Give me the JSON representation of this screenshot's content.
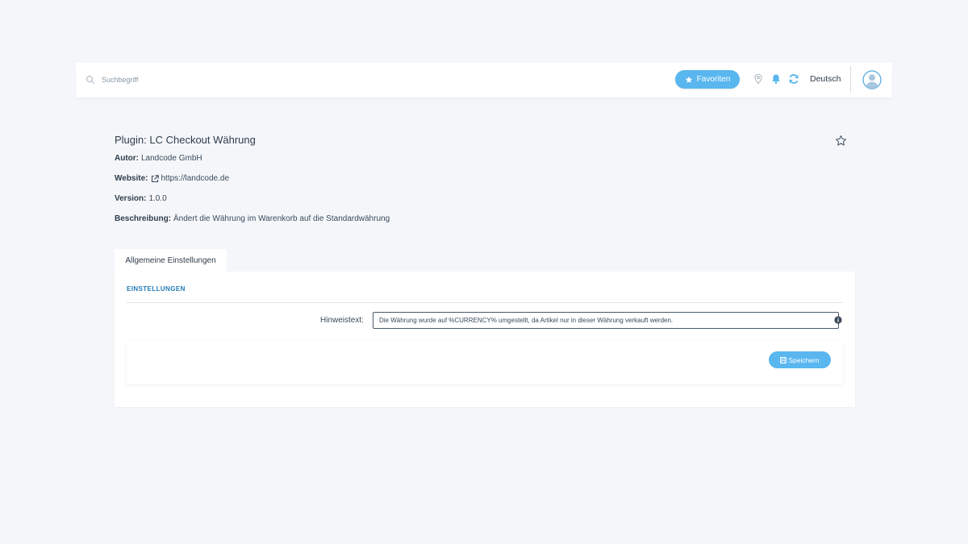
{
  "search": {
    "placeholder": "Suchbegriff"
  },
  "topbar": {
    "favorites_label": "Favoriten",
    "language": "Deutsch"
  },
  "plugin": {
    "title": "Plugin: LC Checkout Währung",
    "author_label": "Autor:",
    "author": "Landcode GmbH",
    "website_label": "Website:",
    "website": "https://landcode.de",
    "version_label": "Version:",
    "version": "1.0.0",
    "description_label": "Beschreibung:",
    "description": "Ändert die Währung im Warenkorb auf die Standardwährung"
  },
  "tabs": [
    {
      "label": "Allgemeine Einstellungen"
    }
  ],
  "settings": {
    "section_title": "EINSTELLUNGEN",
    "hint_label": "Hinweistext:",
    "hint_value": "Die Währung wurde auf %CURRENCY% umgestellt, da Artikel nur in dieser Währung verkauft werden.",
    "save_label": "Speichern"
  },
  "colors": {
    "accent": "#59b6ef",
    "section_title": "#1f7bb5",
    "background": "#f4f6fa"
  },
  "icons": [
    "search-icon",
    "star-icon",
    "location-pin-icon",
    "bell-icon",
    "refresh-icon",
    "user-avatar-icon",
    "external-link-icon",
    "star-outline-icon",
    "info-icon",
    "save-icon"
  ]
}
